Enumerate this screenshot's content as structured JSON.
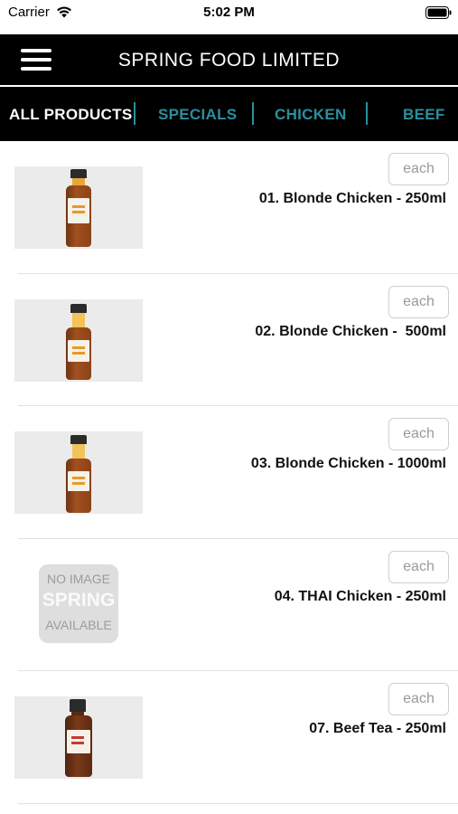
{
  "status_bar": {
    "carrier": "Carrier",
    "time": "5:02 PM",
    "icons": [
      "wifi-icon",
      "battery-icon"
    ]
  },
  "nav_bar": {
    "title": "SPRING FOOD LIMITED",
    "menu_icon": "hamburger-menu-icon"
  },
  "tabs": [
    {
      "label": "ALL PRODUCTS",
      "active": true
    },
    {
      "label": "SPECIALS",
      "active": false
    },
    {
      "label": "CHICKEN",
      "active": false
    },
    {
      "label": "BEEF",
      "active": false
    }
  ],
  "colors": {
    "nav_background": "#000000",
    "active_tab": "#ffffff",
    "inactive_tab": "#2a8f9e"
  },
  "products": [
    {
      "name": "01. Blonde Chicken - 250ml",
      "unit_label": "each",
      "image": "sauce-bottle"
    },
    {
      "name": "02. Blonde Chicken -  500ml",
      "unit_label": "each",
      "image": "sauce-bottle"
    },
    {
      "name": "03. Blonde Chicken - 1000ml",
      "unit_label": "each",
      "image": "sauce-bottle"
    },
    {
      "name": "04. THAI Chicken - 250ml",
      "unit_label": "each",
      "image": "placeholder",
      "placeholder": {
        "top": "NO IMAGE",
        "brand": "SPRING",
        "bottom": "AVAILABLE"
      }
    },
    {
      "name": "07. Beef Tea - 250ml",
      "unit_label": "each",
      "image": "sauce-bottle"
    }
  ]
}
